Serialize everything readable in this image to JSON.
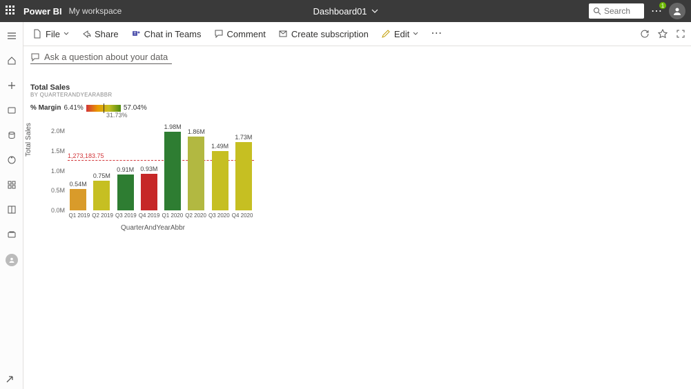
{
  "header": {
    "brand": "Power BI",
    "workspace": "My workspace",
    "dashboard_name": "Dashboard01",
    "search_placeholder": "Search",
    "notification_count": "1"
  },
  "toolbar": {
    "file": "File",
    "share": "Share",
    "teams": "Chat in Teams",
    "comment": "Comment",
    "subscribe": "Create subscription",
    "edit": "Edit"
  },
  "qa": {
    "placeholder": "Ask a question about your data"
  },
  "viz": {
    "title": "Total Sales",
    "subtitle": "By QuarterAndYearAbbr",
    "legend_measure": "% Margin",
    "legend_min": "6.41%",
    "legend_mid": "31.73%",
    "legend_max": "57.04%",
    "ref_label": "1,273,183.75",
    "xaxis": "QuarterAndYearAbbr",
    "yaxis": "Total Sales"
  },
  "chart_data": {
    "type": "bar",
    "categories": [
      "Q1 2019",
      "Q2 2019",
      "Q3 2019",
      "Q4 2019",
      "Q1 2020",
      "Q2 2020",
      "Q3 2020",
      "Q4 2020"
    ],
    "series": [
      {
        "name": "Total Sales",
        "values": [
          540000,
          750000,
          910000,
          930000,
          1980000,
          1860000,
          1490000,
          1730000
        ]
      }
    ],
    "data_labels": [
      "0.54M",
      "0.75M",
      "0.91M",
      "0.93M",
      "1.98M",
      "1.86M",
      "1.49M",
      "1.73M"
    ],
    "bar_colors": [
      "#d99b2a",
      "#c6bf22",
      "#2e7d32",
      "#c62828",
      "#2e7d32",
      "#b2b841",
      "#c6bf22",
      "#c6bf22"
    ],
    "reference_line": 1273183.75,
    "ylim": [
      0,
      2000000
    ],
    "yticks": [
      0,
      500000,
      1000000,
      1500000,
      2000000
    ],
    "ytick_labels": [
      "0.0M",
      "0.5M",
      "1.0M",
      "1.5M",
      "2.0M"
    ],
    "xlabel": "QuarterAndYearAbbr",
    "ylabel": "Total Sales",
    "title": "Total Sales"
  }
}
